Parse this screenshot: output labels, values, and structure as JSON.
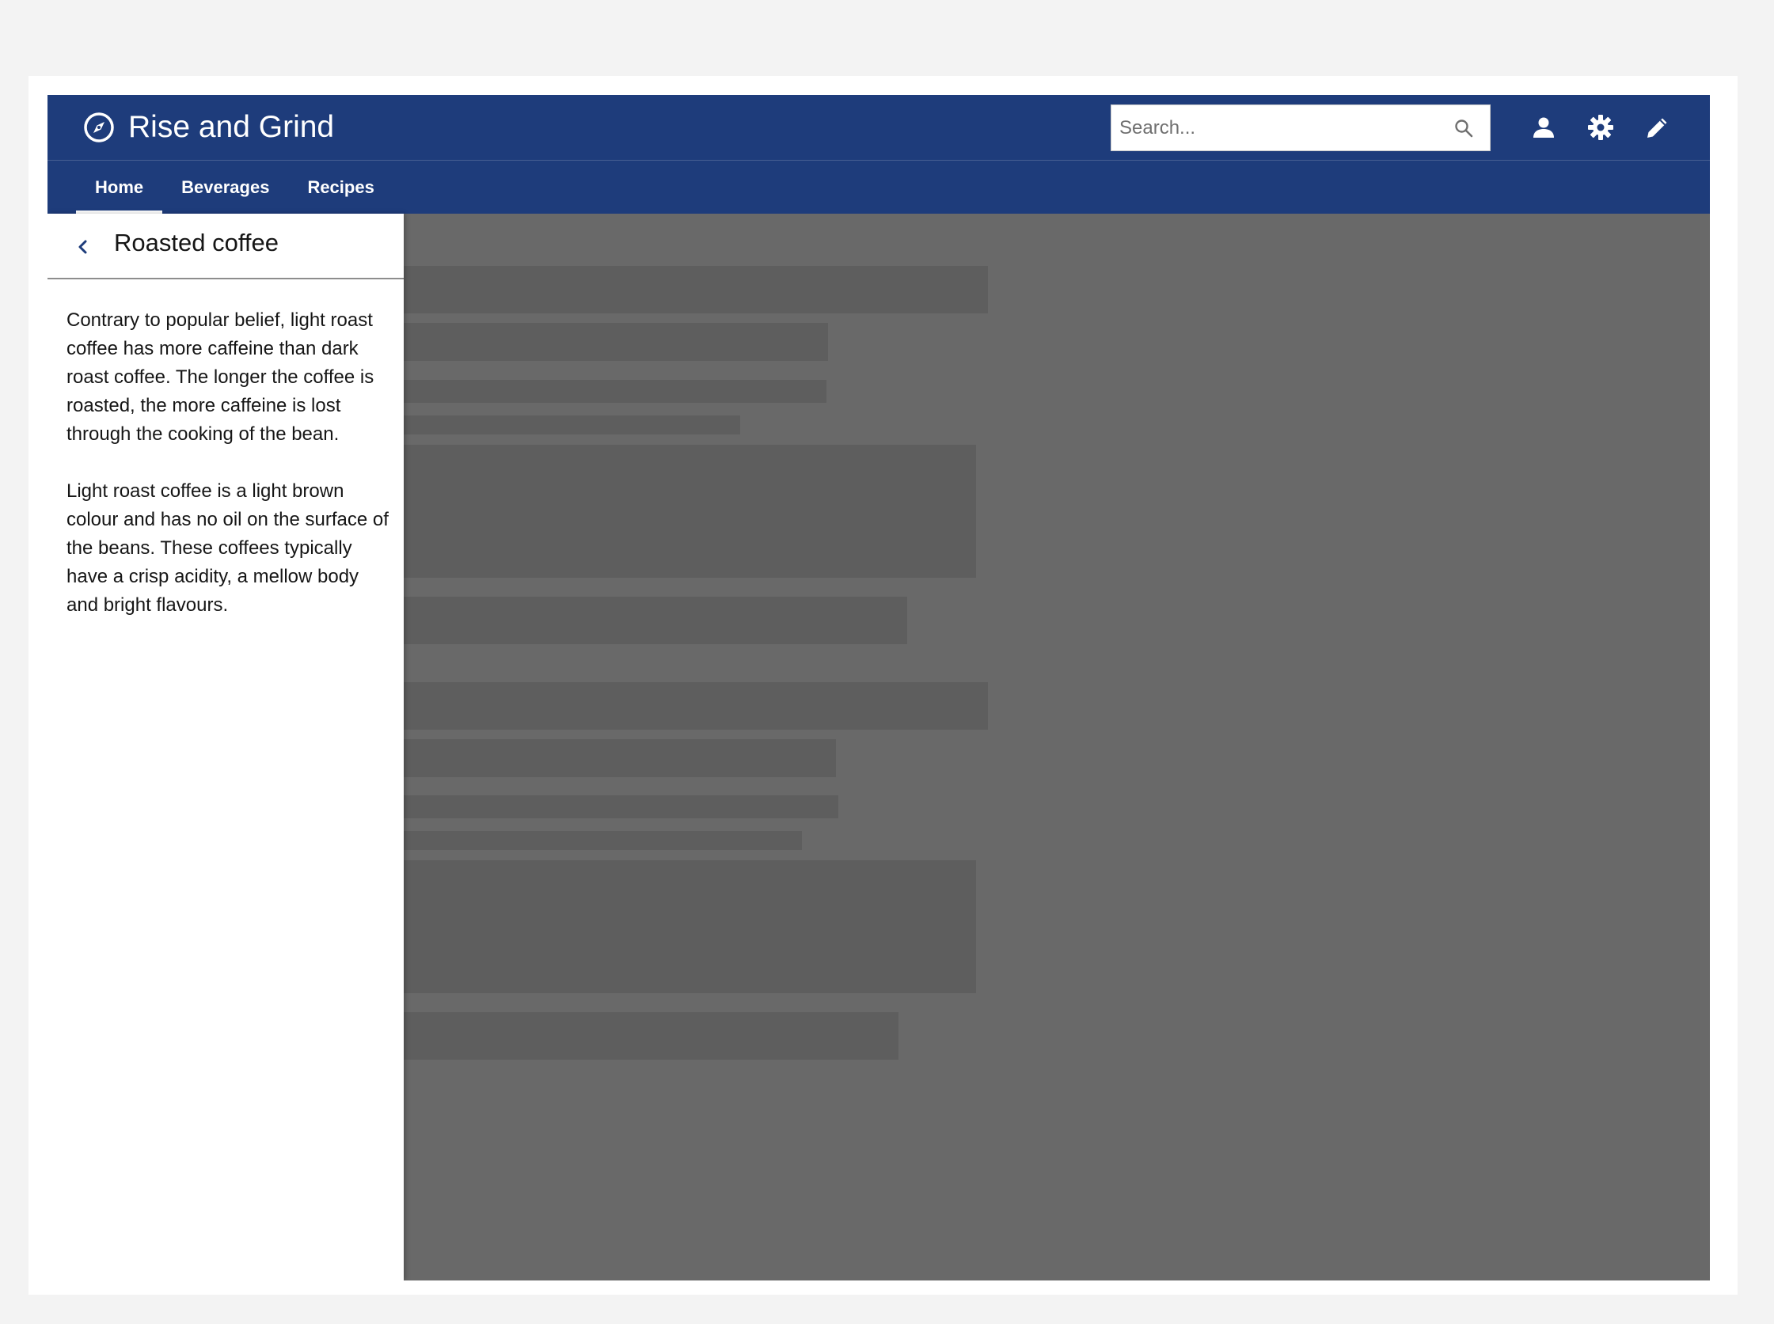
{
  "app": {
    "title": "Rise and Grind"
  },
  "search": {
    "placeholder": "Search..."
  },
  "nav": {
    "tabs": [
      {
        "label": "Home",
        "active": true
      },
      {
        "label": "Beverages",
        "active": false
      },
      {
        "label": "Recipes",
        "active": false
      }
    ]
  },
  "header_actions": [
    "user-icon",
    "settings-icon",
    "edit-icon"
  ],
  "panel": {
    "title": "Roasted coffee",
    "paragraphs": [
      "Contrary to popular belief, light roast coffee has more caffeine than dark roast coffee. The longer the coffee is roasted, the more caffeine is lost through the cooking of the bean.",
      "Light roast coffee is a light brown colour and has no oil on the surface of the beans. These coffees typically have a crisp acidity, a mellow body and bright flavours."
    ]
  },
  "colors": {
    "header_bg": "#1e3c7b",
    "overlay": "rgba(0,0,0,0.59)",
    "page_bg": "#f3f3f3",
    "text": "#161616"
  }
}
